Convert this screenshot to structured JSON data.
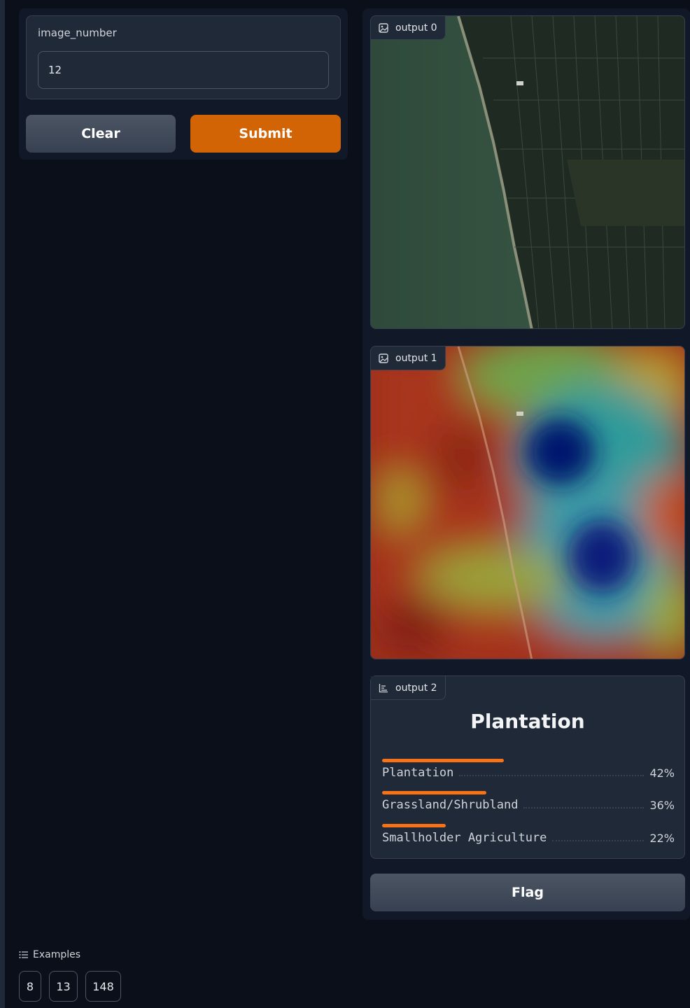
{
  "inputs": {
    "image_number_label": "image_number",
    "image_number_value": "12"
  },
  "buttons": {
    "clear": "Clear",
    "submit": "Submit",
    "flag": "Flag"
  },
  "outputs": {
    "output0_label": "output 0",
    "output1_label": "output 1",
    "output2_label": "output 2"
  },
  "classification": {
    "top_label": "Plantation",
    "confidences": [
      {
        "label": "Plantation",
        "percent": "42%",
        "value": 0.42
      },
      {
        "label": "Grassland/Shrubland",
        "percent": "36%",
        "value": 0.36
      },
      {
        "label": "Smallholder Agriculture",
        "percent": "22%",
        "value": 0.22
      }
    ]
  },
  "examples": {
    "header": "Examples",
    "items": [
      "8",
      "13",
      "148"
    ]
  },
  "colors": {
    "accent": "#d26405",
    "bar": "#f97316",
    "background": "#0b0f19"
  }
}
